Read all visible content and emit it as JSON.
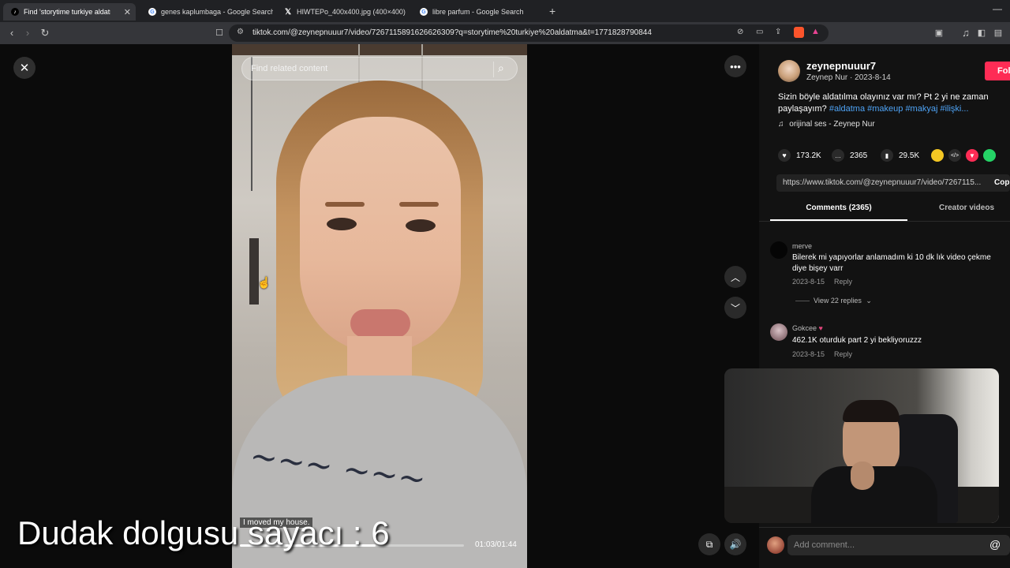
{
  "browser": {
    "tabs": [
      {
        "title": "Find 'storytime turkiye aldatm",
        "active": true,
        "favicon": "tiktok-icon"
      },
      {
        "title": "genes kaplumbaga - Google Search",
        "active": false,
        "favicon": "google-icon"
      },
      {
        "title": "HIWTEPo_400x400.jpg (400×400)",
        "active": false,
        "favicon": "x-icon"
      },
      {
        "title": "libre parfum - Google Search",
        "active": false,
        "favicon": "google-icon"
      }
    ],
    "url": "tiktok.com/@zeynepnuuur7/video/7267115891626626309?q=storytime%20turkiye%20aldatma&t=1771828790844"
  },
  "video": {
    "search_placeholder": "Find related content",
    "caption_overlay": "I moved my house.",
    "time": "01:03/01:44",
    "progress": 0.605,
    "overlay_text": "Dudak dolgusu  sayacı : 6"
  },
  "author": {
    "username": "zeynepnuuur7",
    "display_and_date": "Zeynep Nur · 2023-8-14",
    "follow_label": "Fol"
  },
  "description": {
    "text": "Sizin böyle aldatılma olayınız var mı? Pt 2 yi ne zaman paylaşayım?",
    "hashtags": "#aldatma #makeup #makyaj #ilişki...",
    "music": "orijinal ses - Zeynep Nur"
  },
  "stats": {
    "likes": "173.2K",
    "comments": "2365",
    "saves": "29.5K"
  },
  "share": {
    "link": "https://www.tiktok.com/@zeynepnuuur7/video/7267115...",
    "copy_label": "Cop"
  },
  "tabs": {
    "comments": "Comments (2365)",
    "creator": "Creator videos"
  },
  "comments": [
    {
      "user": "merve",
      "text": "Bilerek mi yapıyorlar anlamadım ki 10 dk lık video çekme diye bişey varr",
      "date": "2023-8-15",
      "reply": "Reply",
      "view_replies": "View 22 replies"
    },
    {
      "user": "Gokcee",
      "text": "462.1K oturduk part 2 yi bekliyoruzzz",
      "date": "2023-8-15",
      "reply": "Reply"
    }
  ],
  "composer": {
    "placeholder": "Add comment..."
  },
  "colors": {
    "accent_pink": "#fe2c55",
    "hashtag_blue": "#4ea3f5",
    "panel_bg": "#121212"
  }
}
